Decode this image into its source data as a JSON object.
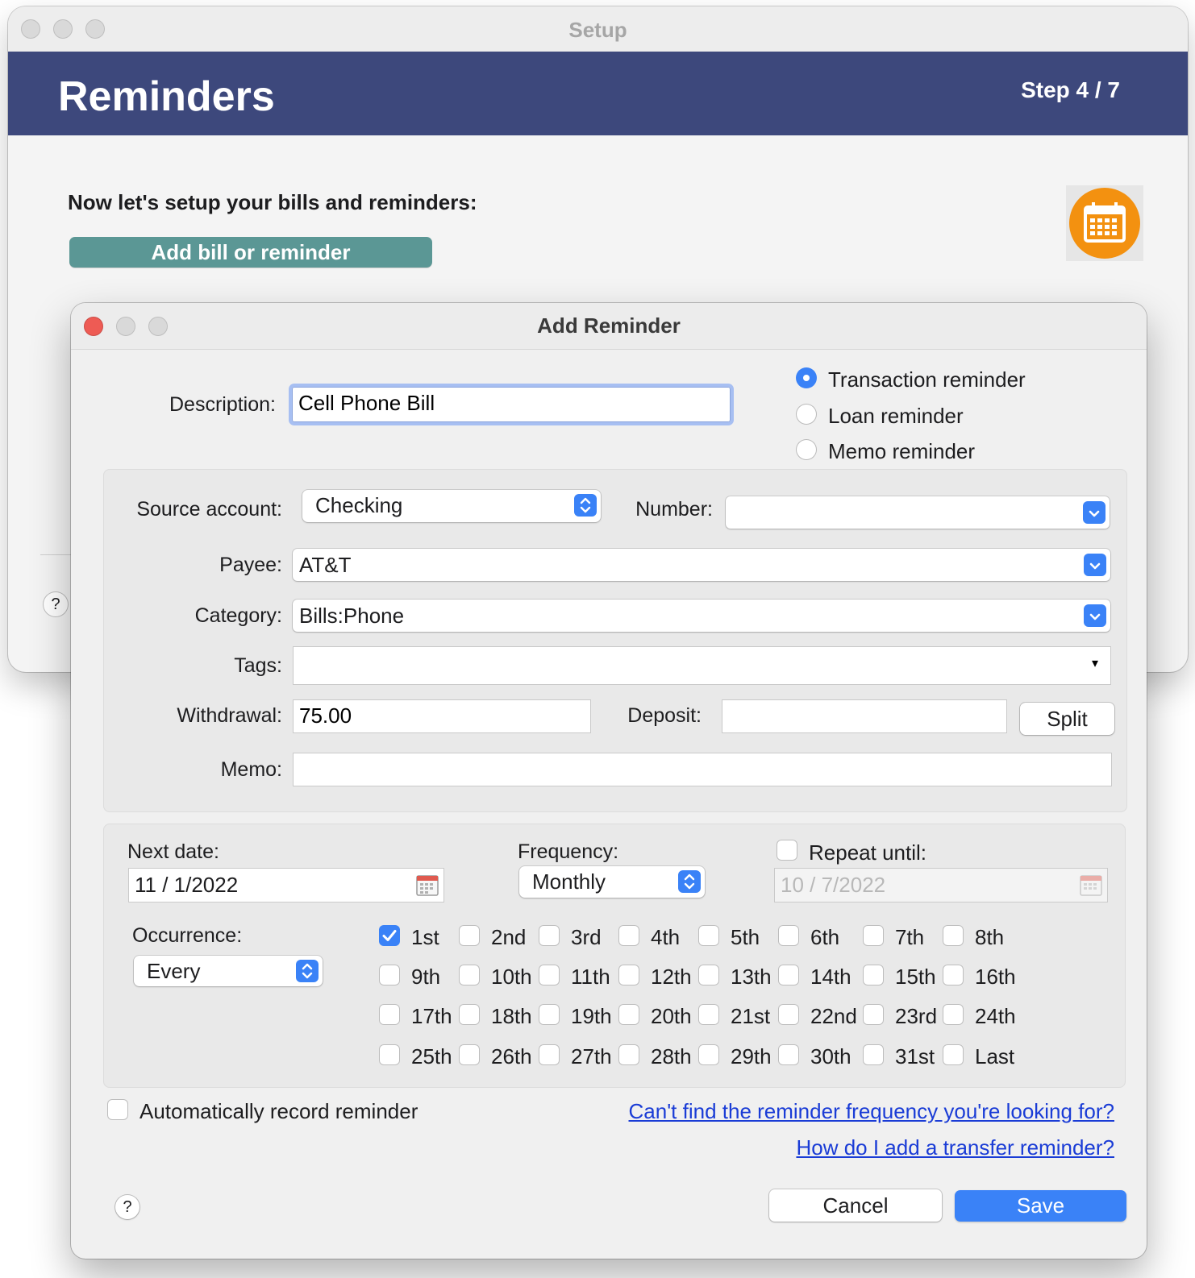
{
  "setup_window": {
    "title": "Setup",
    "header_title": "Reminders",
    "step": "Step 4 / 7",
    "intro": "Now let's setup your bills and reminders:",
    "add_button": "Add bill or reminder",
    "help": "?",
    "header_color": "#3d487c",
    "calendar_icon": "calendar-icon"
  },
  "dialog": {
    "title": "Add Reminder",
    "description": {
      "label": "Description:",
      "value": "Cell Phone Bill"
    },
    "reminder_types": [
      {
        "label": "Transaction reminder",
        "selected": true
      },
      {
        "label": "Loan reminder",
        "selected": false
      },
      {
        "label": "Memo reminder",
        "selected": false
      }
    ],
    "source_account": {
      "label": "Source account:",
      "value": "Checking"
    },
    "number": {
      "label": "Number:",
      "value": ""
    },
    "payee": {
      "label": "Payee:",
      "value": "AT&T"
    },
    "category": {
      "label": "Category:",
      "value": "Bills:Phone"
    },
    "tags": {
      "label": "Tags:",
      "value": "",
      "arrow": "▾"
    },
    "withdrawal": {
      "label": "Withdrawal:",
      "value": "75.00"
    },
    "deposit": {
      "label": "Deposit:",
      "value": ""
    },
    "split_button": "Split",
    "memo": {
      "label": "Memo:",
      "value": ""
    },
    "next_date": {
      "label": "Next date:",
      "value": "11 /  1/2022"
    },
    "frequency": {
      "label": "Frequency:",
      "value": "Monthly"
    },
    "repeat_until": {
      "label": "Repeat until:",
      "value": "10 /  7/2022",
      "checked": false
    },
    "occurrence": {
      "label": "Occurrence:",
      "value": "Every"
    },
    "days": [
      {
        "label": "1st",
        "checked": true
      },
      {
        "label": "2nd",
        "checked": false
      },
      {
        "label": "3rd",
        "checked": false
      },
      {
        "label": "4th",
        "checked": false
      },
      {
        "label": "5th",
        "checked": false
      },
      {
        "label": "6th",
        "checked": false
      },
      {
        "label": "7th",
        "checked": false
      },
      {
        "label": "8th",
        "checked": false
      },
      {
        "label": "9th",
        "checked": false
      },
      {
        "label": "10th",
        "checked": false
      },
      {
        "label": "11th",
        "checked": false
      },
      {
        "label": "12th",
        "checked": false
      },
      {
        "label": "13th",
        "checked": false
      },
      {
        "label": "14th",
        "checked": false
      },
      {
        "label": "15th",
        "checked": false
      },
      {
        "label": "16th",
        "checked": false
      },
      {
        "label": "17th",
        "checked": false
      },
      {
        "label": "18th",
        "checked": false
      },
      {
        "label": "19th",
        "checked": false
      },
      {
        "label": "20th",
        "checked": false
      },
      {
        "label": "21st",
        "checked": false
      },
      {
        "label": "22nd",
        "checked": false
      },
      {
        "label": "23rd",
        "checked": false
      },
      {
        "label": "24th",
        "checked": false
      },
      {
        "label": "25th",
        "checked": false
      },
      {
        "label": "26th",
        "checked": false
      },
      {
        "label": "27th",
        "checked": false
      },
      {
        "label": "28th",
        "checked": false
      },
      {
        "label": "29th",
        "checked": false
      },
      {
        "label": "30th",
        "checked": false
      },
      {
        "label": "31st",
        "checked": false
      },
      {
        "label": "Last",
        "checked": false
      }
    ],
    "auto_record": {
      "label": "Automatically record reminder",
      "checked": false
    },
    "links": [
      "Can't find the reminder frequency you're looking for?",
      "How do I add a transfer reminder?"
    ],
    "help": "?",
    "cancel_button": "Cancel",
    "save_button": "Save",
    "accent_color": "#3a82f7",
    "link_color": "#1a3cd6"
  }
}
